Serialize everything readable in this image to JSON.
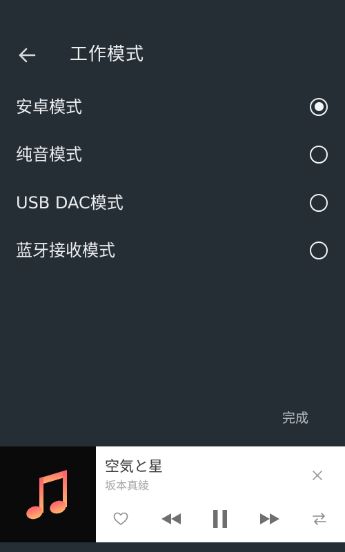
{
  "header": {
    "back_icon": "arrow-left-icon",
    "title": "工作模式"
  },
  "modes": [
    {
      "label": "安卓模式",
      "selected": true
    },
    {
      "label": "纯音模式",
      "selected": false
    },
    {
      "label": "USB DAC模式",
      "selected": false
    },
    {
      "label": "蓝牙接收模式",
      "selected": false
    }
  ],
  "done_label": "完成",
  "player": {
    "title": "空気と星",
    "artist": "坂本真綾",
    "album_art_icon": "music-note-icon",
    "controls": [
      "heart-icon",
      "previous-icon",
      "pause-icon",
      "next-icon",
      "repeat-icon",
      "close-icon"
    ]
  },
  "colors": {
    "background": "#262e35",
    "text": "#eceff1",
    "muted_text": "#b9c0c5",
    "player_bg": "#ffffff",
    "note_gradient_top": "#ff5e6c",
    "note_gradient_bottom": "#ffb86c"
  }
}
